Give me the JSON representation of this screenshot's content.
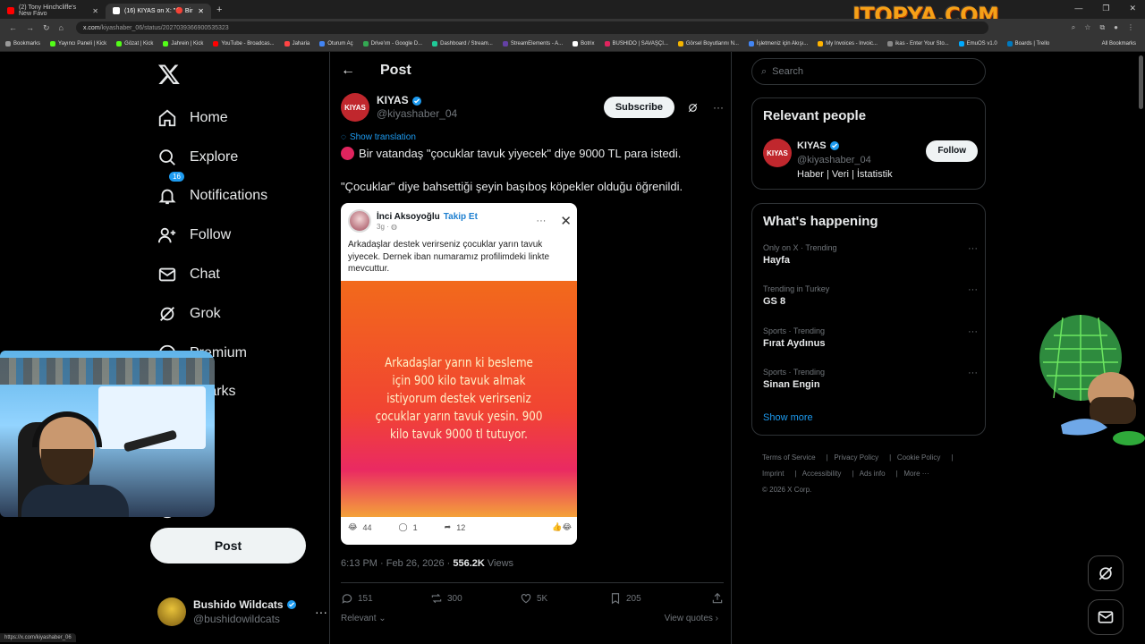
{
  "browser": {
    "tabs": [
      {
        "label": "(2) Tony Hinchcliffe's New Favo",
        "color": "#ff0000"
      },
      {
        "label": "(16) KIYAS on X: \"🔴 Bir vatandaş",
        "color": "#ffffff"
      }
    ],
    "url_host": "x.com",
    "url_path": "/kiyashaber_06/status/2027039366900535323",
    "status_url": "https://x.com/kiyashaber_06",
    "brand": "ITOPYA.COM",
    "bookmarks": [
      {
        "label": "Bookmarks",
        "color": "#999999"
      },
      {
        "label": "Yayıncı Paneli | Kick",
        "color": "#53fc18"
      },
      {
        "label": "Gözat | Kick",
        "color": "#53fc18"
      },
      {
        "label": "Jahrein | Kick",
        "color": "#53fc18"
      },
      {
        "label": "YouTube - Broadcas...",
        "color": "#ff0000"
      },
      {
        "label": "Jaharia",
        "color": "#ff4444"
      },
      {
        "label": "Oturum Aç",
        "color": "#4285f4"
      },
      {
        "label": "Drive'ım - Google D...",
        "color": "#34a853"
      },
      {
        "label": "Dashboard / Stream...",
        "color": "#20c997"
      },
      {
        "label": "StreamElements - A...",
        "color": "#6441a5"
      },
      {
        "label": "Botrix",
        "color": "#ffffff"
      },
      {
        "label": "BUSHIDO | SAVAŞÇI...",
        "color": "#e0245e"
      },
      {
        "label": "Görsel Boyutlarını N...",
        "color": "#f4b400"
      },
      {
        "label": "İşletmeniz için Akışı...",
        "color": "#4285f4"
      },
      {
        "label": "My Invoices - Invoic...",
        "color": "#ffb300"
      },
      {
        "label": "ikas - Enter Your Sto...",
        "color": "#888888"
      },
      {
        "label": "EmuOS v1.0",
        "color": "#00aaff"
      },
      {
        "label": "Boards | Trello",
        "color": "#0079bf"
      }
    ],
    "all_bookmarks": "All Bookmarks"
  },
  "sidebar": {
    "items": [
      {
        "label": "Home",
        "icon": "home-icon"
      },
      {
        "label": "Explore",
        "icon": "search-icon"
      },
      {
        "label": "Notifications",
        "icon": "bell-icon",
        "badge": "16"
      },
      {
        "label": "Follow",
        "icon": "follow-icon"
      },
      {
        "label": "Chat",
        "icon": "mail-icon"
      },
      {
        "label": "Grok",
        "icon": "grok-icon"
      },
      {
        "label": "Premium",
        "icon": "premium-icon"
      },
      {
        "label": "Bookmarks",
        "visible_text": "kmarks",
        "icon": "bookmark-icon"
      },
      {
        "label": "Articles",
        "visible_text": "cles",
        "icon": "article-icon"
      },
      {
        "label": "Profile",
        "visible_text": "file",
        "icon": "profile-icon"
      },
      {
        "label": "More",
        "visible_text": "re",
        "icon": "more-icon"
      }
    ],
    "post_button": "Post",
    "account": {
      "display_name": "Bushido Wildcats",
      "handle": "@bushidowildcats"
    }
  },
  "post": {
    "header": "Post",
    "author": {
      "display_name": "KIYAS",
      "handle": "@kiyashaber_04",
      "avatar_text": "KIYAS"
    },
    "subscribe": "Subscribe",
    "show_translation": "Show translation",
    "text1": "Bir vatandaş \"çocuklar tavuk yiyecek\" diye 9000 TL para istedi.",
    "text2": "\"Çocuklar\" diye bahsettiği şeyin başıboş köpekler olduğu öğrenildi.",
    "embed": {
      "name": "İnci Aksoyoğlu",
      "follow": "Takip Et",
      "time": "3g · ",
      "text": "Arkadaşlar destek verirseniz çocuklar yarın tavuk yiyecek. Dernek iban numaramız  profilimdeki linkte mevcuttur.",
      "image_text": "Arkadaşlar yarın ki besleme için 900 kilo tavuk almak istiyorum destek verirseniz çocuklar yarın tavuk yesin. 900 kilo tavuk 9000 tl tutuyor.",
      "reactions": "44",
      "comments": "1",
      "shares": "12"
    },
    "timestamp": "6:13 PM · Feb 26, 2026 · ",
    "views_count": "556.2K",
    "views_label": " Views",
    "stats": {
      "replies": "151",
      "reposts": "300",
      "likes": "5K",
      "bookmarks": "205"
    },
    "relevant": "Relevant",
    "view_quotes": "View quotes"
  },
  "right": {
    "search_placeholder": "Search",
    "relevant_title": "Relevant people",
    "person": {
      "display_name": "KIYAS",
      "handle": "@kiyashaber_04",
      "bio": "Haber | Veri | İstatistik",
      "follow": "Follow"
    },
    "happening_title": "What's happening",
    "trends": [
      {
        "category": "Only on X · Trending",
        "name": "Hayfa"
      },
      {
        "category": "Trending in Turkey",
        "name": "GS 8"
      },
      {
        "category": "Sports · Trending",
        "name": "Fırat Aydınus"
      },
      {
        "category": "Sports · Trending",
        "name": "Sinan Engin"
      }
    ],
    "show_more": "Show more",
    "footer_line1": [
      "Terms of Service",
      "Privacy Policy",
      "Cookie Policy"
    ],
    "footer_line2": [
      "Imprint",
      "Accessibility",
      "Ads info",
      "More ···"
    ],
    "copyright": "© 2026 X Corp."
  },
  "colors": {
    "accent": "#1d9bf0",
    "brand_red": "#c0272d",
    "background": "#000000"
  }
}
